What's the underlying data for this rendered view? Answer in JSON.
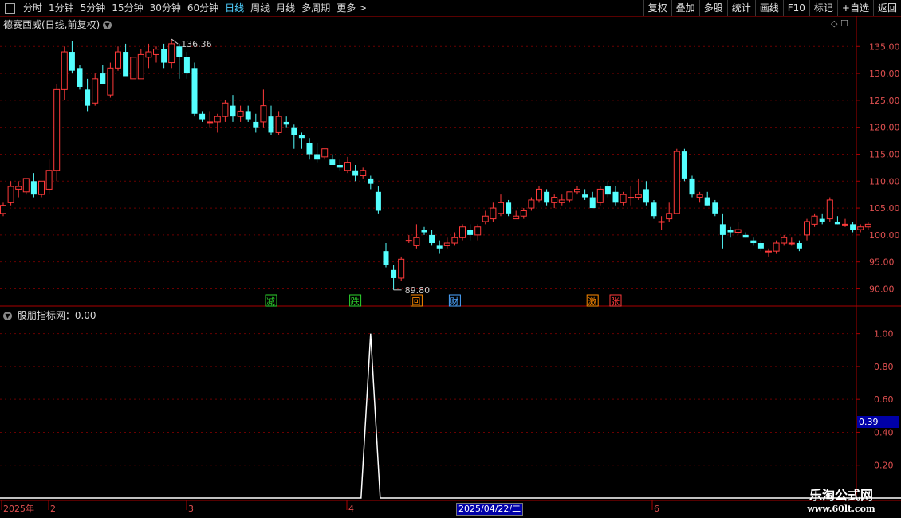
{
  "toolbar": {
    "left_items": [
      {
        "label": "分时"
      },
      {
        "label": "1分钟"
      },
      {
        "label": "5分钟"
      },
      {
        "label": "15分钟"
      },
      {
        "label": "30分钟"
      },
      {
        "label": "60分钟"
      },
      {
        "label": "日线",
        "active": true
      },
      {
        "label": "周线"
      },
      {
        "label": "月线"
      },
      {
        "label": "多周期"
      },
      {
        "label": "更多 >"
      }
    ],
    "right_items": [
      "复权",
      "叠加",
      "多股",
      "统计",
      "画线",
      "F10",
      "标记",
      "+自选",
      "返回"
    ]
  },
  "main_title": "德赛西威(日线,前复权)",
  "indicator_title": "股朋指标网：0.00",
  "indicator_value_box": "0.39",
  "date_box": "2025/04/22/二",
  "logo": {
    "line1": "乐淘公式网",
    "line2": "www.60lt.com"
  },
  "colors": {
    "up": "#ff3a3a",
    "down": "#54ffff",
    "grid": "#6a0000",
    "axis_text": "#e05050"
  },
  "chart_data": {
    "type": "candlestick",
    "y_ticks": [
      "135.00",
      "130.00",
      "125.00",
      "120.00",
      "115.00",
      "110.00",
      "105.00",
      "100.00",
      "95.00",
      "90.00"
    ],
    "y_range": [
      88,
      138
    ],
    "max_label": "136.36",
    "min_label": "89.80",
    "x_labels": [
      "2025年",
      "2",
      "3",
      "4",
      "6"
    ],
    "candles": [
      [
        104,
        106,
        103.5,
        105.5
      ],
      [
        106,
        110,
        105.5,
        109
      ],
      [
        108.5,
        110,
        107,
        109
      ],
      [
        108,
        110.5,
        107.5,
        110.5
      ],
      [
        110,
        111.5,
        107,
        107.5
      ],
      [
        107.5,
        110,
        107,
        110
      ],
      [
        108.5,
        114,
        107.5,
        112
      ],
      [
        112,
        128,
        110,
        127
      ],
      [
        127,
        135,
        125,
        134
      ],
      [
        134,
        136,
        130,
        130.5
      ],
      [
        131,
        131.5,
        127,
        127.5
      ],
      [
        127,
        129,
        123,
        124
      ],
      [
        124.5,
        130,
        124,
        129
      ],
      [
        130,
        131.5,
        128,
        128
      ],
      [
        126,
        132,
        125.5,
        131
      ],
      [
        131,
        135,
        130.5,
        134
      ],
      [
        134,
        135.5,
        130,
        129.5
      ],
      [
        129,
        133,
        129,
        133
      ],
      [
        129,
        134.5,
        129,
        133.5
      ],
      [
        133,
        135.5,
        131,
        134
      ],
      [
        133.5,
        135,
        132,
        134.5
      ],
      [
        134.5,
        135.5,
        131,
        132
      ],
      [
        132,
        136.36,
        131,
        135.5
      ],
      [
        135,
        135.5,
        129,
        133
      ],
      [
        133,
        134,
        129,
        130
      ],
      [
        131,
        132,
        122,
        122.5
      ],
      [
        122.5,
        123,
        121,
        121.5
      ],
      [
        121,
        123,
        120,
        121
      ],
      [
        121,
        122.5,
        119,
        122
      ],
      [
        122,
        125,
        121,
        124.5
      ],
      [
        124,
        126,
        121,
        122
      ],
      [
        122,
        124,
        121,
        123
      ],
      [
        123,
        124,
        121,
        121.5
      ],
      [
        121,
        122.5,
        119,
        120
      ],
      [
        121,
        127,
        120,
        124
      ],
      [
        122,
        124,
        118.5,
        119
      ],
      [
        119,
        123,
        118.5,
        122
      ],
      [
        121,
        122,
        120,
        120.5
      ],
      [
        120,
        120.5,
        116,
        118.5
      ],
      [
        118.5,
        119,
        116,
        118
      ],
      [
        117,
        118,
        114,
        115
      ],
      [
        115,
        117,
        113.5,
        114
      ],
      [
        114.5,
        116,
        114,
        116
      ],
      [
        114,
        115,
        113,
        113
      ],
      [
        113,
        114,
        112,
        112.5
      ],
      [
        112,
        114.5,
        111.5,
        113.5
      ],
      [
        112,
        113,
        110,
        111
      ],
      [
        111,
        112.5,
        110.5,
        112
      ],
      [
        110.5,
        111,
        108.5,
        109.5
      ],
      [
        108,
        109,
        104,
        104.5
      ],
      [
        97,
        98.5,
        94,
        94.5
      ],
      [
        93.5,
        94.5,
        89.8,
        92
      ],
      [
        92,
        96,
        91.5,
        95.5
      ],
      [
        99,
        100,
        98.5,
        99
      ],
      [
        98,
        102,
        97.5,
        99.5
      ],
      [
        101,
        101.5,
        100,
        100.5
      ],
      [
        100,
        101,
        98,
        98.5
      ],
      [
        98,
        99,
        96.5,
        97.5
      ],
      [
        98,
        99.5,
        97.5,
        98.5
      ],
      [
        98.5,
        100.5,
        98,
        99.5
      ],
      [
        99.5,
        102,
        99,
        101.5
      ],
      [
        101,
        102,
        99,
        100
      ],
      [
        100,
        102,
        99,
        101.5
      ],
      [
        102.5,
        104.5,
        102,
        103.5
      ],
      [
        103,
        106,
        102.5,
        105
      ],
      [
        104,
        107.5,
        103.5,
        106
      ],
      [
        106,
        106.5,
        103.5,
        104
      ],
      [
        103,
        104.5,
        103,
        103.5
      ],
      [
        103.5,
        105,
        103,
        104.5
      ],
      [
        105,
        107,
        104.5,
        106.5
      ],
      [
        106.5,
        109,
        106,
        108.5
      ],
      [
        108,
        108.5,
        105.5,
        106
      ],
      [
        106,
        107.5,
        105,
        107
      ],
      [
        106,
        107.5,
        105.5,
        106.5
      ],
      [
        106.5,
        108,
        106,
        108
      ],
      [
        108,
        109,
        107.5,
        108.5
      ],
      [
        107.5,
        108.5,
        106.5,
        107
      ],
      [
        107,
        108,
        105,
        105
      ],
      [
        106,
        109,
        105.5,
        108.5
      ],
      [
        109,
        110,
        107,
        107.5
      ],
      [
        108,
        109,
        105.5,
        106
      ],
      [
        106,
        108,
        105.5,
        107.5
      ],
      [
        107,
        109,
        105.5,
        107
      ],
      [
        107,
        110.5,
        106.5,
        107.5
      ],
      [
        108.5,
        110,
        105.5,
        106
      ],
      [
        106,
        106.5,
        103,
        103.5
      ],
      [
        102.5,
        103.5,
        101,
        102.5
      ],
      [
        103,
        106,
        102.5,
        104
      ],
      [
        104,
        116,
        104,
        115.5
      ],
      [
        115.5,
        116,
        110,
        110.5
      ],
      [
        110.5,
        111,
        107,
        107.5
      ],
      [
        107,
        108,
        106,
        107.5
      ],
      [
        107,
        108,
        105.5,
        105.5
      ],
      [
        106,
        106.5,
        103.5,
        104
      ],
      [
        102,
        104,
        97.5,
        100
      ],
      [
        101,
        101.5,
        99.5,
        100.5
      ],
      [
        100.5,
        102.5,
        100,
        101
      ],
      [
        100,
        100.5,
        99.5,
        99.5
      ],
      [
        99,
        99.5,
        98,
        98.5
      ],
      [
        98.5,
        99,
        97,
        97.5
      ],
      [
        97,
        97.5,
        96,
        97
      ],
      [
        97,
        99,
        96.5,
        98.5
      ],
      [
        98.5,
        100,
        98,
        99.5
      ],
      [
        98.5,
        99.5,
        98,
        98.5
      ],
      [
        98.5,
        99,
        97,
        97.5
      ],
      [
        100,
        103,
        99,
        102.5
      ],
      [
        102,
        104,
        101.5,
        103.5
      ],
      [
        103,
        104,
        102,
        102.5
      ],
      [
        103,
        107,
        102.5,
        106.5
      ],
      [
        102.5,
        103.5,
        102,
        102
      ],
      [
        102,
        103,
        101.5,
        102
      ],
      [
        102,
        102.5,
        100.5,
        101
      ],
      [
        101,
        102,
        100.5,
        101.5
      ],
      [
        101.5,
        102.5,
        101,
        102
      ]
    ],
    "markers": [
      {
        "candle": 35,
        "text": "减",
        "color": "#2ed52e"
      },
      {
        "candle": 46,
        "text": "跌",
        "color": "#2ed52e"
      },
      {
        "candle": 54,
        "text": "回",
        "color": "#ff8a00"
      },
      {
        "candle": 59,
        "text": "财",
        "color": "#4da6ff"
      },
      {
        "candle": 77,
        "text": "激",
        "color": "#ff8a00"
      },
      {
        "candle": 80,
        "text": "张",
        "color": "#ff3a3a"
      }
    ],
    "indicator": {
      "y_ticks": [
        "1.00",
        "0.80",
        "0.60",
        "0.40",
        "0.20"
      ],
      "y_range": [
        0,
        1.1
      ],
      "spike_candle": 48,
      "spike_value": 1.0
    }
  }
}
